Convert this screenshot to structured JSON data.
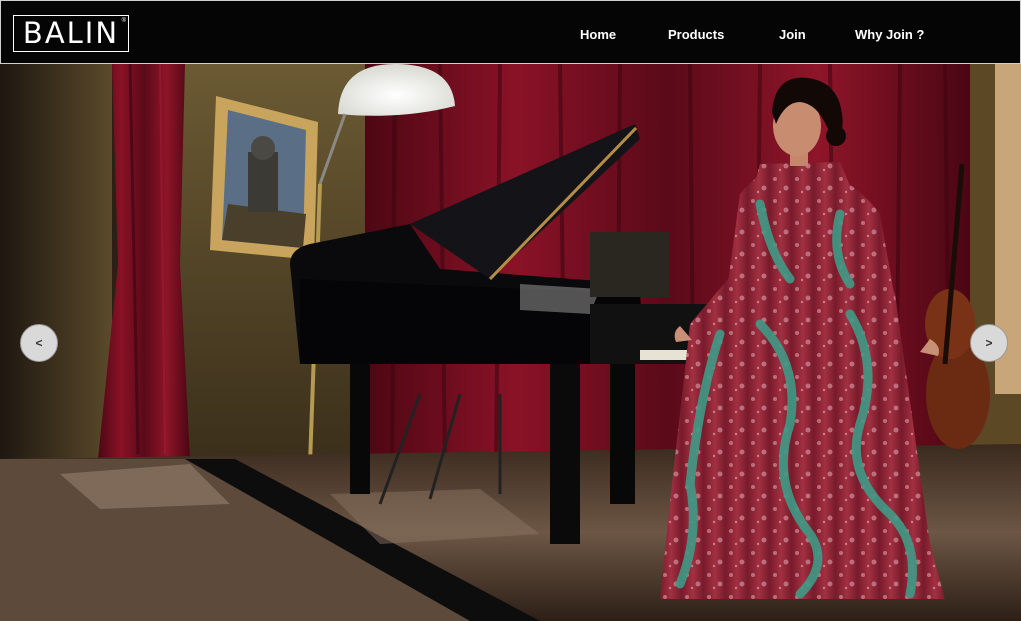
{
  "brand": {
    "logo_text": "BALIN",
    "logo_mark": "®"
  },
  "nav": {
    "items": [
      {
        "label": "Home"
      },
      {
        "label": "Products"
      },
      {
        "label": "Join"
      },
      {
        "label": "Why Join ?"
      }
    ]
  },
  "slider": {
    "prev_label": "<",
    "next_label": ">"
  },
  "colors": {
    "header_bg": "#050505",
    "curtain": "#7a0f22",
    "dress": "#8c2234",
    "dress_pattern": "#3f9a86"
  }
}
